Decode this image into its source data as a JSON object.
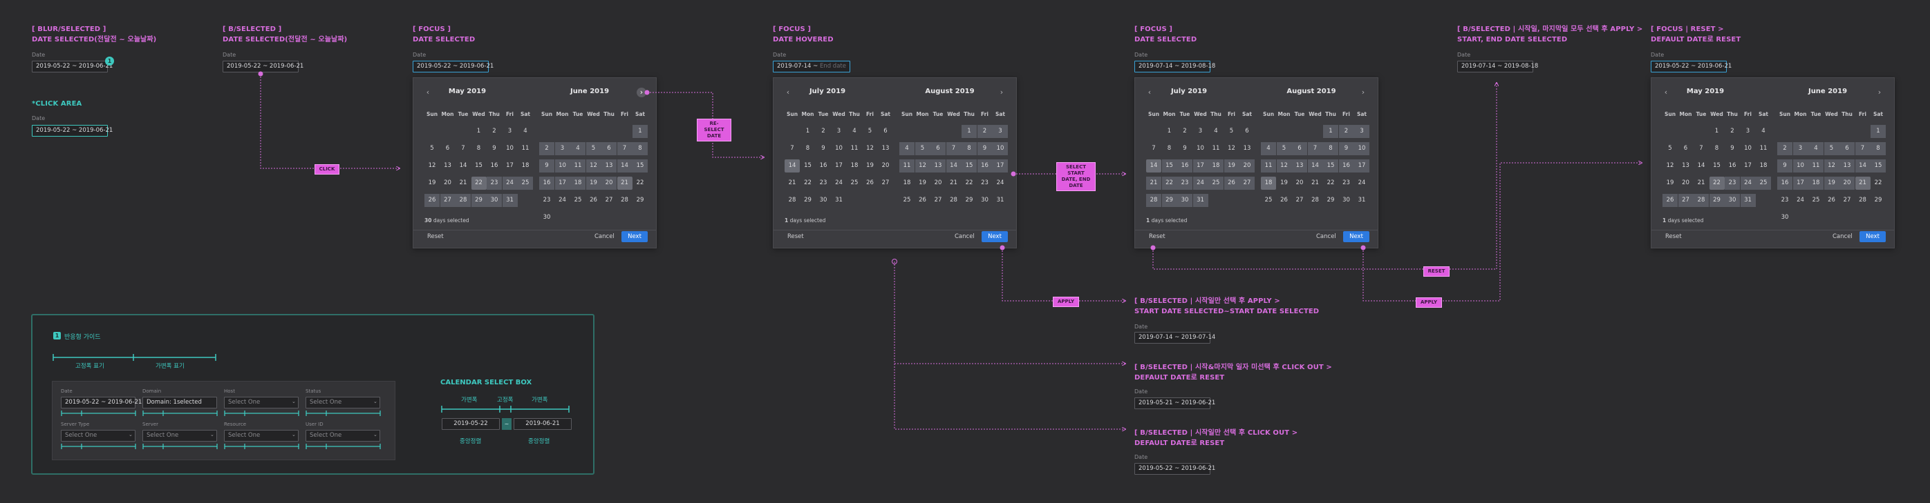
{
  "colors": {
    "bg": "#2b2b2d",
    "magenta": "#d76ddd",
    "teal": "#3ec9c0",
    "accent": "#2c7ae0",
    "focus_border": "#3aa3d6"
  },
  "date_label": "Date",
  "states": [
    {
      "id": "s1",
      "tag": "[ BLUR/SELECTED ]",
      "title": "DATE SELECTED(전달전 ~ 오늘날짜)",
      "value": "2019-05-22 ~ 2019-06-21",
      "badge": "1"
    },
    {
      "id": "s1b",
      "title": "*CLICK AREA",
      "value": "2019-05-22 ~ 2019-06-21"
    },
    {
      "id": "s2",
      "tag": "[ B/SELECTED ]",
      "title": "DATE SELECTED(전달전 ~ 오늘날짜)",
      "value": "2019-05-22 ~ 2019-06-21"
    },
    {
      "id": "s3",
      "tag": "[ FOCUS ]",
      "title": "DATE SELECTED",
      "value": "2019-05-22 ~ 2019-06-21"
    },
    {
      "id": "s4",
      "tag": "[ FOCUS ]",
      "title": "DATE HOVERED",
      "value": "2019-07-14",
      "placeholder": "End date"
    },
    {
      "id": "s5",
      "tag": "[ FOCUS ]",
      "title": "DATE SELECTED",
      "value": "2019-07-14 ~ 2019-08-18"
    },
    {
      "id": "s6",
      "tag": "[ B/SELECTED | 시작일, 마지막일 모두 선택 후 APPLY >",
      "title": "START, END DATE SELECTED",
      "value": "2019-07-14 ~ 2019-08-18"
    },
    {
      "id": "s7",
      "tag": "[ FOCUS | RESET >",
      "title": "DEFAULT DATE로 RESET",
      "value": "2019-05-22 ~ 2019-06-21"
    },
    {
      "id": "s8",
      "tag": "[ B/SELECTED | 시작일만 선택 후 APPLY >",
      "title": "START DATE SELECTED~START DATE SELECTED",
      "value": "2019-07-14 ~ 2019-07-14"
    },
    {
      "id": "s9",
      "tag": "[ B/SELECTED | 시작&마지막 일자 미선택 후 CLICK OUT >",
      "title": "DEFAULT DATE로 RESET",
      "value": "2019-05-21 ~ 2019-06-21"
    },
    {
      "id": "s10",
      "tag": "[ B/SELECTED | 시작일만 선택 후 CLICK OUT >",
      "title": "DEFAULT DATE로 RESET",
      "value": "2019-05-22 ~ 2019-06-21"
    }
  ],
  "tags": {
    "click": "CLICK",
    "reselect": "RE-SELECT DATE",
    "select_start_end": "SELECT START DATE, END DATE",
    "apply": "APPLY",
    "reset": "RESET"
  },
  "picker": {
    "dows": [
      "Sun",
      "Mon",
      "Tue",
      "Wed",
      "Thu",
      "Fri",
      "Sat"
    ],
    "reset": "Reset",
    "cancel": "Cancel",
    "next": "Next",
    "p1": {
      "left": "May 2019",
      "right": "June 2019",
      "info_num": "30",
      "info_txt": " days selected"
    },
    "p2": {
      "left": "July 2019",
      "right": "August 2019",
      "info_num": "1",
      "info_txt": " days selected"
    },
    "p3": {
      "left": "July 2019",
      "right": "August 2019",
      "info_num": "1",
      "info_txt": " days selected"
    },
    "p4": {
      "left": "May 2019",
      "right": "June 2019",
      "info_num": "1",
      "info_txt": " days selected"
    }
  },
  "guide": {
    "badge": "1",
    "title": "반응형 가이드",
    "fixed": "고정폭 표기",
    "variable": "가변폭 표기",
    "fields": [
      {
        "label": "Date",
        "value": "2019-05-22 ~ 2019-06-21"
      },
      {
        "label": "Domain",
        "value": "Domain: 1selected"
      },
      {
        "label": "Host",
        "value": "Select One"
      },
      {
        "label": "Status",
        "value": "Select One"
      },
      {
        "label": "Server Type",
        "value": "Select One"
      },
      {
        "label": "Server",
        "value": "Select One"
      },
      {
        "label": "Resource",
        "value": "Select One"
      },
      {
        "label": "User ID",
        "value": "Select One"
      }
    ],
    "cal_box_title": "CALENDAR SELECT BOX",
    "cal_var1": "가변폭",
    "cal_fixed": "고정폭",
    "cal_var2": "가변폭",
    "cal_start": "2019-05-22",
    "cal_dash": "~",
    "cal_end": "2019-06-21",
    "center1": "중앙정렬",
    "center2": "중앙정렬"
  }
}
